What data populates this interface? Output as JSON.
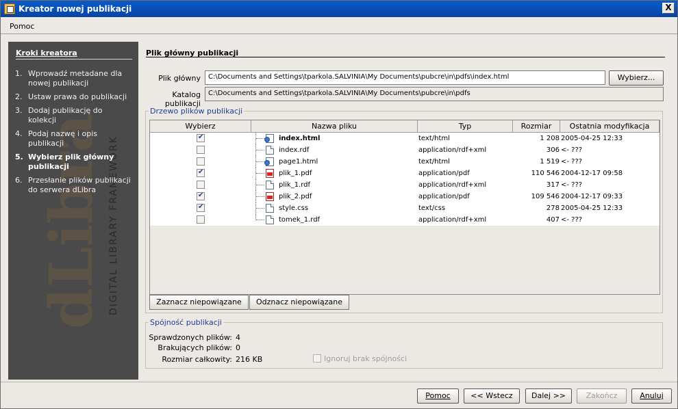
{
  "window": {
    "title": "Kreator nowej publikacji",
    "close_glyph": "X"
  },
  "menu": {
    "items": [
      {
        "label": "Pomoc"
      }
    ]
  },
  "sidebar": {
    "heading": "Kroki kreatora",
    "watermark_text": "DIGITAL LIBRARY FRAMEWORK",
    "watermark_logo": "dLibra",
    "steps": [
      {
        "num": "1.",
        "label": "Wprowadź metadane dla nowej publikacji"
      },
      {
        "num": "2.",
        "label": "Ustaw prawa do publikacji"
      },
      {
        "num": "3.",
        "label": "Dodaj publikację do kolekcji"
      },
      {
        "num": "4.",
        "label": "Podaj nazwę i opis publikacji"
      },
      {
        "num": "5.",
        "label": "Wybierz plik główny publikacji",
        "active": true
      },
      {
        "num": "6.",
        "label": "Przesłanie plików publikacji do serwera dLibra"
      }
    ]
  },
  "main": {
    "title": "Plik główny publikacji",
    "main_file": {
      "label": "Plik główny",
      "value": "C:\\Documents and Settings\\tparkola.SALVINIA\\My Documents\\pubcre\\in\\pdfs\\index.html",
      "button": "Wybierz..."
    },
    "catalog": {
      "label": "Katalog publikacji",
      "value": "C:\\Documents and Settings\\tparkola.SALVINIA\\My Documents\\pubcre\\in\\pdfs"
    }
  },
  "tree": {
    "legend": "Drzewo plików publikacji",
    "columns": [
      "Wybierz",
      "Nazwa pliku",
      "Typ",
      "Rozmiar",
      "Ostatnia modyfikacja"
    ],
    "rows": [
      {
        "checked": true,
        "icon": "web-page-icon",
        "name": "index.html",
        "bold": true,
        "type": "text/html",
        "size": "1 208",
        "modified": "2005-04-25 12:33"
      },
      {
        "checked": false,
        "icon": "document-icon",
        "name": "index.rdf",
        "bold": false,
        "type": "application/rdf+xml",
        "size": "306",
        "modified": "<- ???"
      },
      {
        "checked": false,
        "icon": "web-page-icon",
        "name": "page1.html",
        "bold": false,
        "type": "text/html",
        "size": "1 519",
        "modified": "<- ???"
      },
      {
        "checked": true,
        "icon": "pdf-icon",
        "name": "plik_1.pdf",
        "bold": false,
        "type": "application/pdf",
        "size": "110 546",
        "modified": "2004-12-17 09:58"
      },
      {
        "checked": false,
        "icon": "document-icon",
        "name": "plik_1.rdf",
        "bold": false,
        "type": "application/rdf+xml",
        "size": "317",
        "modified": "<- ???"
      },
      {
        "checked": true,
        "icon": "pdf-icon",
        "name": "plik_2.pdf",
        "bold": false,
        "type": "application/pdf",
        "size": "109 546",
        "modified": "2004-12-17 09:33"
      },
      {
        "checked": true,
        "icon": "document-icon",
        "name": "style.css",
        "bold": false,
        "type": "text/css",
        "size": "278",
        "modified": "2005-04-25 12:33"
      },
      {
        "checked": false,
        "icon": "document-icon",
        "name": "tomek_1.rdf",
        "bold": false,
        "type": "application/rdf+xml",
        "size": "407",
        "modified": "<- ???"
      }
    ],
    "btn_mark": "Zaznacz niepowiązane",
    "btn_unmark": "Odznacz niepowiązane"
  },
  "consistency": {
    "legend": "Spójność publikacji",
    "checked_label": "Sprawdzonych plików:",
    "checked_value": "4",
    "missing_label": "Brakujących plików:",
    "missing_value": "0",
    "total_label": "Rozmiar całkowity:",
    "total_value": "216 KB",
    "ignore_label": "Ignoruj brak spójności"
  },
  "footer": {
    "help": "Pomoc",
    "back": "<< Wstecz",
    "next": "Dalej >>",
    "finish": "Zakończ",
    "cancel": "Anuluj"
  }
}
